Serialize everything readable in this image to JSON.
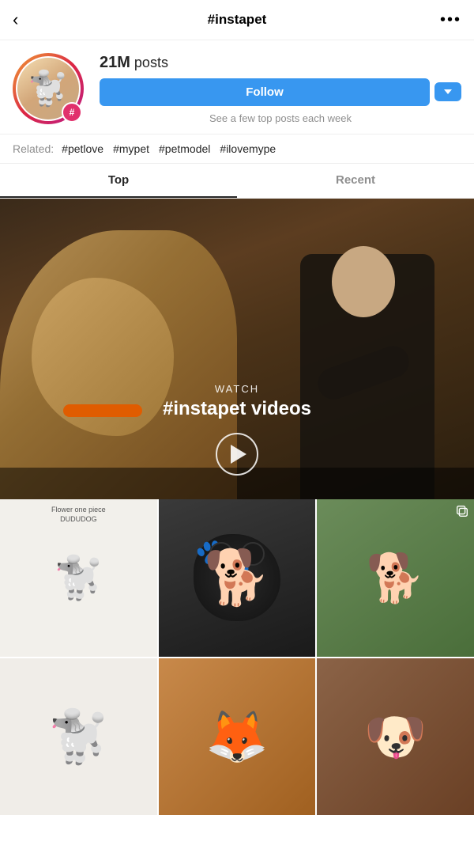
{
  "header": {
    "back_label": "‹",
    "title": "#instapet",
    "more_label": "•••"
  },
  "profile": {
    "posts_count": "21M",
    "posts_label": "posts",
    "follow_label": "Follow",
    "see_few_text": "See a few top posts each week",
    "hashtag_badge": "#"
  },
  "related": {
    "label": "Related:",
    "tags": [
      "#petlove",
      "#mypet",
      "#petmodel",
      "#ilovemype"
    ]
  },
  "tabs": [
    {
      "label": "Top",
      "active": true
    },
    {
      "label": "Recent",
      "active": false
    }
  ],
  "video_section": {
    "watch_label": "WATCH",
    "hashtag_text": "#instapet videos"
  },
  "grid": {
    "cells": [
      {
        "id": "cell-1",
        "caption_line1": "Flower one piece",
        "caption_line2": "DUDUDOG",
        "emoji": "🐩"
      },
      {
        "id": "cell-2",
        "emoji": "🐕‍🦺"
      },
      {
        "id": "cell-3",
        "emoji": "🐕",
        "has_multi": true
      },
      {
        "id": "cell-4",
        "emoji": "🐾"
      },
      {
        "id": "cell-5",
        "emoji": "🐶"
      },
      {
        "id": "cell-6",
        "emoji": "🦊"
      }
    ]
  }
}
